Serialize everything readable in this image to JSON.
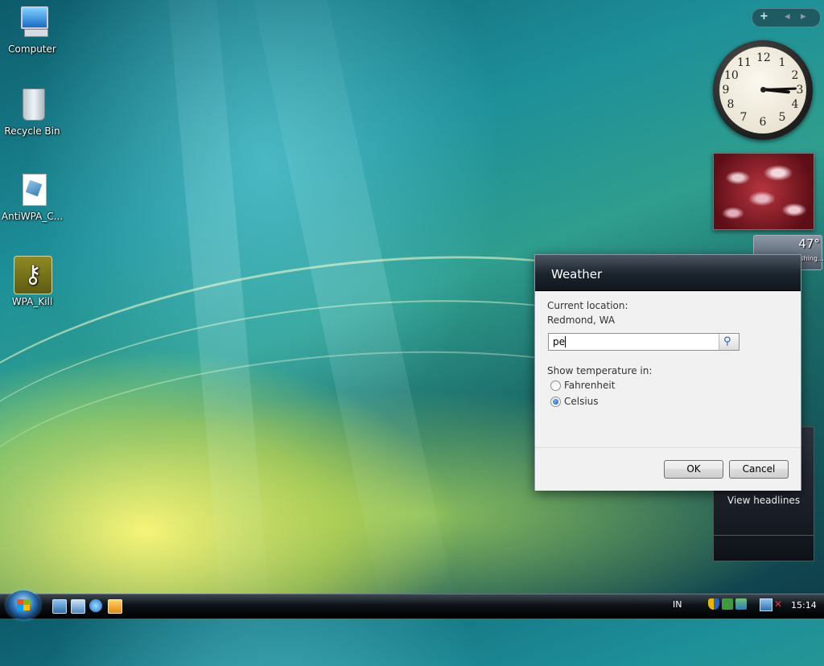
{
  "desktop": {
    "icons": [
      {
        "label": "Computer"
      },
      {
        "label": "Recycle Bin"
      },
      {
        "label": "AntiWPA_C..."
      },
      {
        "label": "WPA_Kill"
      }
    ]
  },
  "gadgets": {
    "toolbar": {
      "add": "+",
      "prev": "◂",
      "next": "▸"
    },
    "clock": {
      "numbers": [
        "12",
        "1",
        "2",
        "3",
        "4",
        "5",
        "6",
        "7",
        "8",
        "9",
        "10",
        "11"
      ],
      "time": "15:14"
    },
    "weather_mini": {
      "temp": "47°",
      "location": "Redmond, Washing..."
    },
    "news": {
      "view_headlines": "View headlines"
    }
  },
  "dialog": {
    "title": "Weather",
    "current_location_label": "Current location:",
    "current_location_value": "Redmond, WA",
    "search_value": "pe",
    "show_temp_label": "Show temperature in:",
    "options": [
      {
        "label": "Fahrenheit",
        "selected": false
      },
      {
        "label": "Celsius",
        "selected": true
      }
    ],
    "ok_label": "OK",
    "cancel_label": "Cancel"
  },
  "taskbar": {
    "language": "IN",
    "time": "15:14"
  },
  "colors": {
    "dialog_title_bg": "#1b232c",
    "accent_blue": "#0b59b3"
  }
}
